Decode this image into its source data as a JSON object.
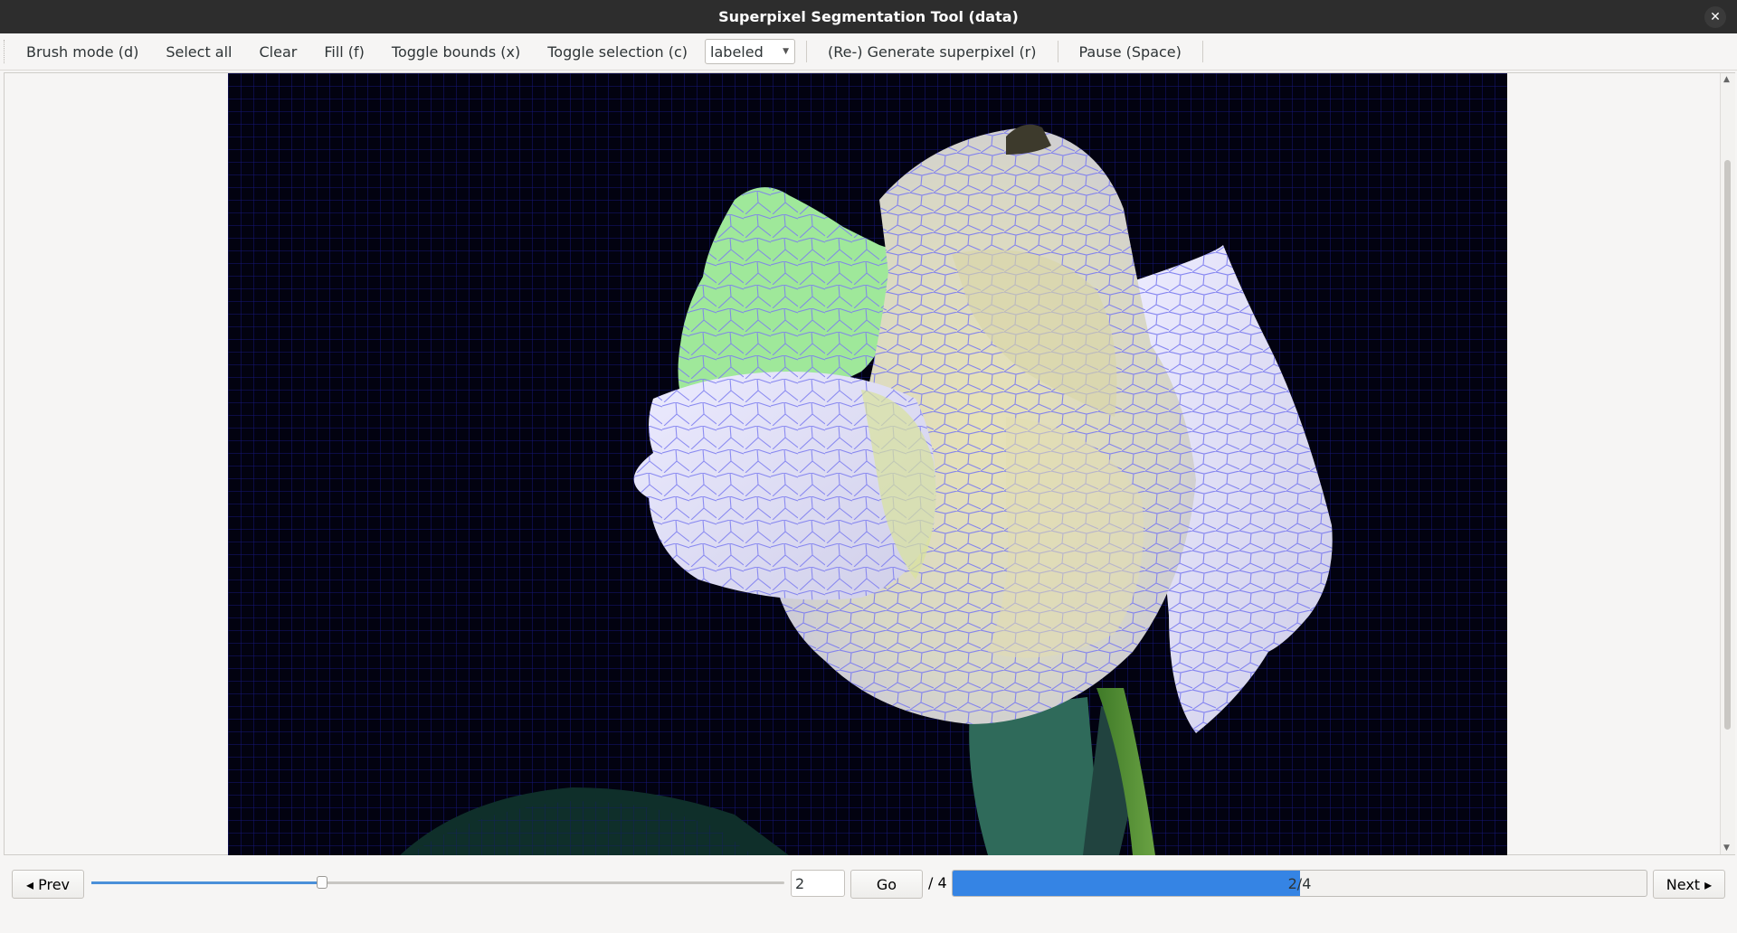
{
  "window": {
    "title": "Superpixel Segmentation Tool (data)",
    "close_glyph": "✕"
  },
  "toolbar": {
    "brush_mode": "Brush mode (d)",
    "select_all": "Select all",
    "clear": "Clear",
    "fill": "Fill (f)",
    "toggle_bounds": "Toggle bounds (x)",
    "toggle_selection": "Toggle selection (c)",
    "mode_select_value": "labeled",
    "generate": "(Re-) Generate superpixel (r)",
    "pause": "Pause (Space)"
  },
  "navigation": {
    "prev": "◂ Prev",
    "next": "Next ▸",
    "page_value": "2",
    "go": "Go",
    "total": "/ 4",
    "progress_text": "2/4",
    "progress_fraction": 0.5,
    "slider_fraction": 0.333
  },
  "image": {
    "description_icon": "image-canvas-icon",
    "overlay_color": "#6f6fe8",
    "grid_color": "#1c1c8a",
    "selected_color": "#9fe89a"
  },
  "colors": {
    "accent": "#3584e4",
    "titlebar": "#2d2d2d"
  }
}
